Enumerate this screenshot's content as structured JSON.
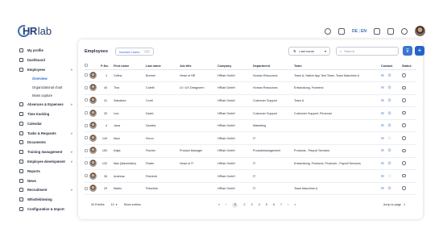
{
  "app": {
    "logo_hr": "HR",
    "logo_lab": "lab",
    "lang_de": "DE",
    "lang_sep": "|",
    "lang_en": "EN"
  },
  "sidebar": {
    "items": [
      {
        "label": "My profile",
        "icon": "user-icon"
      },
      {
        "label": "Dashboard",
        "icon": "dashboard-icon"
      },
      {
        "label": "Employees",
        "icon": "people-icon",
        "expanded": true,
        "children": [
          "Overview",
          "Organizational chart",
          "Mass capture"
        ]
      },
      {
        "label": "Absences & Expenses",
        "icon": "calendar-check-icon",
        "chevron": true
      },
      {
        "label": "Time tracking",
        "icon": "clock-icon"
      },
      {
        "label": "Calendar",
        "icon": "calendar-icon"
      },
      {
        "label": "Tasks & Requests",
        "icon": "tasks-icon",
        "chevron": true
      },
      {
        "label": "Documents",
        "icon": "document-icon"
      },
      {
        "label": "Training management",
        "icon": "training-icon",
        "chevron": true
      },
      {
        "label": "Employee development",
        "icon": "growth-icon",
        "chevron": true
      },
      {
        "label": "Reports",
        "icon": "reports-icon"
      },
      {
        "label": "News",
        "icon": "news-icon"
      },
      {
        "label": "Recruitment",
        "icon": "recruitment-icon",
        "chevron": true
      },
      {
        "label": "Whistleblowing",
        "icon": "whistle-icon"
      },
      {
        "label": "Configuration & Import",
        "icon": "gear-icon"
      }
    ],
    "active_child": "Overview"
  },
  "employees": {
    "title": "Employees",
    "inactive_users_label": "Inactive Users",
    "sort_label": "Last name",
    "search_placeholder": "Search",
    "columns": [
      "P-No.",
      "First name",
      "Last name",
      "Job title",
      "Company",
      "Department",
      "Team",
      "Contact",
      "Status"
    ],
    "rows": [
      {
        "pno": "1",
        "first": "Celina",
        "last": "Bremer",
        "job": "Head of HR",
        "company": "HRlab GmbH",
        "dept": "Human Resources",
        "team": "Team A, Native App Test Team, Team Maschine A",
        "phone": true
      },
      {
        "pno": "40",
        "first": "Tina",
        "last": "Coletti",
        "job": "UI / UX Designerin",
        "company": "HRlab GmbH",
        "dept": "Human Resources",
        "team": "Entwicklung, Frontend",
        "phone": true
      },
      {
        "pno": "31",
        "first": "Salvatore",
        "last": "Conti",
        "job": "",
        "company": "HRlab GmbH",
        "dept": "Customer Support",
        "team": "Team A",
        "phone": true
      },
      {
        "pno": "30",
        "first": "Lea",
        "last": "David",
        "job": "",
        "company": "HRlab GmbH",
        "dept": "Customer Support",
        "team": "Customer Support, Personal",
        "phone": true
      },
      {
        "pno": "4",
        "first": "Jana",
        "last": "Daniels",
        "job": "",
        "company": "HRlab GmbH",
        "dept": "Marketing",
        "team": "",
        "phone": true
      },
      {
        "pno": "149",
        "first": "Maxi",
        "last": "Feron",
        "job": "",
        "company": "HRlab GmbH",
        "dept": "IT",
        "team": "",
        "phone": false
      },
      {
        "pno": "150",
        "first": "Katja",
        "last": "Fischer",
        "job": "Product Manager",
        "company": "HRlab GmbH",
        "dept": "Produktmanagement",
        "team": "Products - Payroll Services",
        "phone": true
      },
      {
        "pno": "132",
        "first": "Max (Maximilian)",
        "last": "Flutter",
        "job": "Head of IT",
        "company": "HRlab GmbH",
        "dept": "IT",
        "team": "Entwicklung, Frontend, Products - Payroll Services",
        "phone": true
      },
      {
        "pno": "36",
        "first": "Andreas",
        "last": "Friedrich",
        "job": "",
        "company": "HRlab GmbH",
        "dept": "IT",
        "team": "",
        "phone": false
      },
      {
        "pno": "29",
        "first": "Martin",
        "last": "Fritschke",
        "job": "",
        "company": "HRlab GmbH",
        "dept": "IT",
        "team": "Team Maschine A",
        "phone": true
      }
    ],
    "footer": {
      "entries": "34 Entries",
      "rows_per_page": "10",
      "show_entries": "Show entries",
      "pages": [
        "1",
        "2",
        "3",
        "4",
        "5",
        "6",
        "7"
      ],
      "current_page": "1",
      "jump_label": "Jump to page",
      "jump_value": "1"
    }
  }
}
